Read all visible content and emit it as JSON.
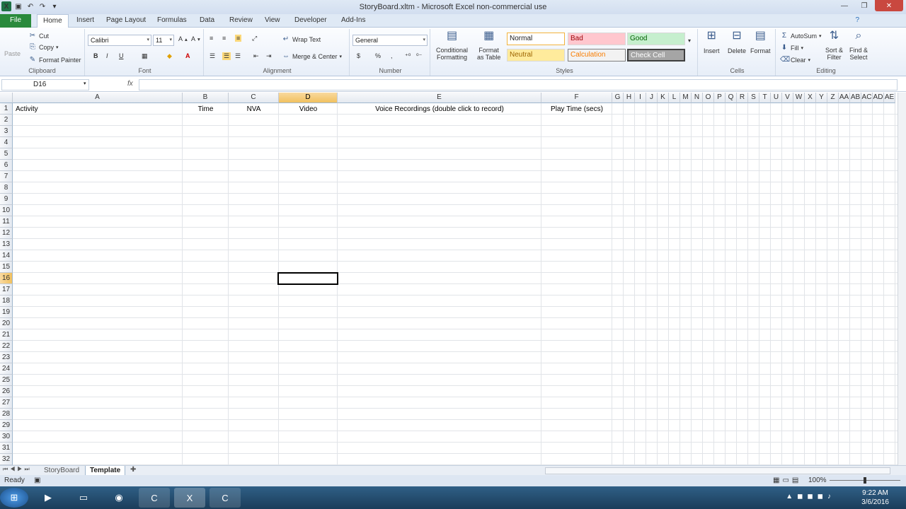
{
  "window": {
    "title": "StoryBoard.xltm - Microsoft Excel non-commercial use"
  },
  "tabs": [
    "File",
    "Home",
    "Insert",
    "Page Layout",
    "Formulas",
    "Data",
    "Review",
    "View",
    "Developer",
    "Add-Ins"
  ],
  "clipboard": {
    "paste": "Paste",
    "cut": "Cut",
    "copy": "Copy",
    "format_painter": "Format Painter",
    "label": "Clipboard"
  },
  "font": {
    "name": "Calibri",
    "size": "11",
    "label": "Font",
    "bold": "B",
    "italic": "I",
    "underline": "U"
  },
  "alignment": {
    "wrap": "Wrap Text",
    "merge": "Merge & Center",
    "label": "Alignment"
  },
  "number": {
    "format": "General",
    "currency": "$",
    "percent": "%",
    "comma": ",",
    "label": "Number"
  },
  "styles": {
    "conditional": "Conditional\nFormatting",
    "format_table": "Format\nas Table",
    "normal": "Normal",
    "bad": "Bad",
    "good": "Good",
    "neutral": "Neutral",
    "calculation": "Calculation",
    "check": "Check Cell",
    "label": "Styles"
  },
  "cells": {
    "insert": "Insert",
    "delete": "Delete",
    "format": "Format",
    "label": "Cells"
  },
  "editing": {
    "autosum": "AutoSum",
    "fill": "Fill",
    "clear": "Clear",
    "sort": "Sort &\nFilter",
    "find": "Find &\nSelect",
    "label": "Editing"
  },
  "formula_bar": {
    "name_box": "D16",
    "fx": "fx",
    "value": ""
  },
  "columns": [
    "A",
    "B",
    "C",
    "D",
    "E",
    "F",
    "G",
    "H",
    "I",
    "J",
    "K",
    "L",
    "M",
    "N",
    "O",
    "P",
    "Q",
    "R",
    "S",
    "T",
    "U",
    "V",
    "W",
    "X",
    "Y",
    "Z",
    "AA",
    "AB",
    "AC",
    "AD",
    "AE"
  ],
  "rows": [
    "1",
    "2",
    "3",
    "4",
    "5",
    "6",
    "7",
    "8",
    "9",
    "10",
    "11",
    "12",
    "13",
    "14",
    "15",
    "16",
    "17",
    "18",
    "19",
    "20",
    "21",
    "22",
    "23",
    "24",
    "25",
    "26",
    "27",
    "28",
    "29",
    "30",
    "31",
    "32"
  ],
  "header_row": {
    "A": "Activity",
    "B": "Time",
    "C": "NVA",
    "D": "Video",
    "E": "Voice Recordings (double click to record)",
    "F": "Play Time (secs)"
  },
  "sheets": [
    "StoryBoard",
    "Template"
  ],
  "status": {
    "ready": "Ready",
    "zoom": "100%"
  },
  "clock": {
    "time": "9:22 AM",
    "date": "3/6/2016"
  }
}
